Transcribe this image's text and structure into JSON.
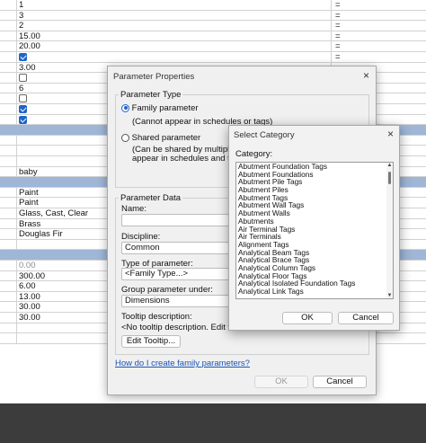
{
  "grid": {
    "rows": [
      {
        "type": "text",
        "value": "1",
        "right": "="
      },
      {
        "type": "text",
        "value": "3",
        "right": "="
      },
      {
        "type": "text",
        "value": "2",
        "right": "="
      },
      {
        "type": "text",
        "value": "15.00",
        "right": "="
      },
      {
        "type": "text",
        "value": "20.00",
        "right": "="
      },
      {
        "type": "check",
        "checked": true,
        "right": "="
      },
      {
        "type": "text",
        "value": "3.00",
        "right": "="
      },
      {
        "type": "check",
        "checked": false,
        "right": "="
      },
      {
        "type": "text",
        "value": "6",
        "right": "="
      },
      {
        "type": "check",
        "checked": false,
        "right": "="
      },
      {
        "type": "check",
        "checked": true,
        "right": "="
      },
      {
        "type": "check",
        "checked": true,
        "right": "="
      },
      {
        "type": "header"
      },
      {
        "type": "text",
        "value": ""
      },
      {
        "type": "text",
        "value": ""
      },
      {
        "type": "text",
        "value": ""
      },
      {
        "type": "text",
        "value": "baby"
      },
      {
        "type": "header"
      },
      {
        "type": "text",
        "value": "Paint"
      },
      {
        "type": "text",
        "value": "Paint"
      },
      {
        "type": "text",
        "value": "Glass, Cast, Clear"
      },
      {
        "type": "text",
        "value": "Brass"
      },
      {
        "type": "text",
        "value": "Douglas Fir"
      },
      {
        "type": "text",
        "value": ""
      },
      {
        "type": "header"
      },
      {
        "type": "grey",
        "value": "0.00"
      },
      {
        "type": "text",
        "value": "300.00"
      },
      {
        "type": "text",
        "value": "6.00"
      },
      {
        "type": "text",
        "value": "13.00"
      },
      {
        "type": "text",
        "value": "30.00"
      },
      {
        "type": "text",
        "value": "30.00"
      },
      {
        "type": "text",
        "value": ""
      },
      {
        "type": "text",
        "value": ""
      }
    ]
  },
  "parameter_properties": {
    "title": "Parameter Properties",
    "close_glyph": "×",
    "parameter_type_label": "Parameter Type",
    "family_param_label": "Family parameter",
    "family_param_note": "(Cannot appear in schedules or tags)",
    "shared_param_label": "Shared parameter",
    "shared_param_note_1": "(Can be shared by multiple proje",
    "shared_param_note_2": "appear in schedules and tags)",
    "parameter_data_label": "Parameter Data",
    "name_label": "Name:",
    "name_value": "",
    "discipline_label": "Discipline:",
    "discipline_value": "Common",
    "type_label": "Type of parameter:",
    "type_value": "<Family Type...>",
    "group_label": "Group parameter under:",
    "group_value": "Dimensions",
    "tooltip_label": "Tooltip description:",
    "tooltip_value": "<No tooltip description. Edit this para",
    "edit_tooltip_button": "Edit Tooltip...",
    "help_link": "How do I create family parameters?",
    "ok_button": "OK",
    "cancel_button": "Cancel"
  },
  "select_category": {
    "title": "Select Category",
    "close_glyph": "×",
    "category_label": "Category:",
    "items": [
      "Abutment Foundation Tags",
      "Abutment Foundations",
      "Abutment Pile Tags",
      "Abutment Piles",
      "Abutment Tags",
      "Abutment Wall Tags",
      "Abutment Walls",
      "Abutments",
      "Air Terminal Tags",
      "Air Terminals",
      "Alignment Tags",
      "Analytical Beam Tags",
      "Analytical Brace Tags",
      "Analytical Column Tags",
      "Analytical Floor Tags",
      "Analytical Isolated Foundation Tags",
      "Analytical Link Tags"
    ],
    "ok_button": "OK",
    "cancel_button": "Cancel"
  },
  "colors": {
    "section_header": "#9fb6d6",
    "accent": "#1f64c8",
    "link": "#1a55b8"
  }
}
